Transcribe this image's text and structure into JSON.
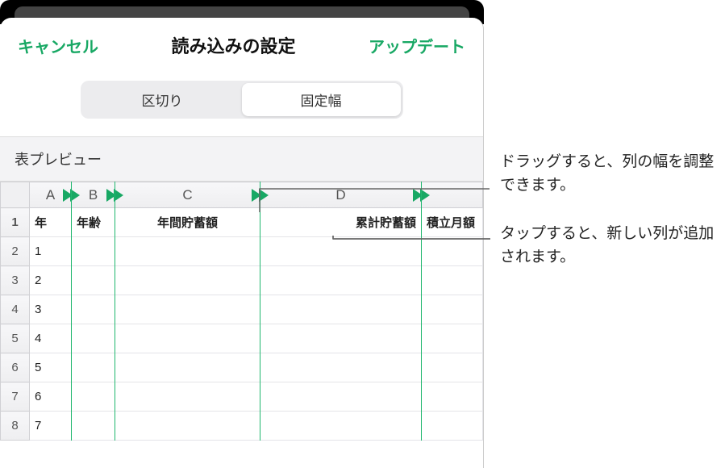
{
  "nav": {
    "cancel": "キャンセル",
    "title": "読み込みの設定",
    "update": "アップデート"
  },
  "segmented": {
    "delimited": "区切り",
    "fixed": "固定幅"
  },
  "section": {
    "preview_label": "表プレビュー"
  },
  "columns": [
    "A",
    "B",
    "C",
    "D",
    ""
  ],
  "headers": {
    "c0": "年",
    "c1": "年齢",
    "c2": "年間貯蓄額",
    "c3": "累計貯蓄額",
    "c4": "積立月額"
  },
  "rows": [
    "1",
    "2",
    "3",
    "4",
    "5",
    "6",
    "7",
    "8"
  ],
  "data_col0": [
    "1",
    "2",
    "3",
    "4",
    "5",
    "6",
    "7"
  ],
  "callouts": {
    "drag": "ドラッグすると、列の幅を調整できます。",
    "tap": "タップすると、新しい列が追加されます。"
  }
}
